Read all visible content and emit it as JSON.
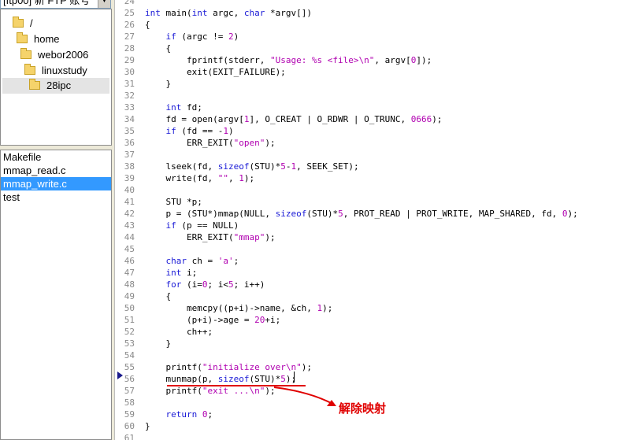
{
  "account_selector": {
    "value": "[ftp00] 新 FTP 账号"
  },
  "tree": {
    "items": [
      {
        "label": "/",
        "selected": false
      },
      {
        "label": "home",
        "selected": false
      },
      {
        "label": "webor2006",
        "selected": false
      },
      {
        "label": "linuxstudy",
        "selected": false
      },
      {
        "label": "28ipc",
        "selected": true
      }
    ]
  },
  "files": {
    "items": [
      {
        "label": "Makefile",
        "selected": false
      },
      {
        "label": "mmap_read.c",
        "selected": false
      },
      {
        "label": "mmap_write.c",
        "selected": true
      },
      {
        "label": "test",
        "selected": false
      }
    ]
  },
  "editor": {
    "line_numbers": [
      "24",
      "25",
      "26",
      "27",
      "28",
      "29",
      "30",
      "31",
      "32",
      "33",
      "34",
      "35",
      "36",
      "37",
      "38",
      "39",
      "40",
      "41",
      "42",
      "43",
      "44",
      "45",
      "46",
      "47",
      "48",
      "49",
      "50",
      "51",
      "52",
      "53",
      "54",
      "55",
      "56",
      "57",
      "58",
      "59",
      "60",
      "61"
    ],
    "current_line": "56",
    "lines": [
      "",
      "int main(int argc, char *argv[])",
      "{",
      "    if (argc != 2)",
      "    {",
      "        fprintf(stderr, \"Usage: %s <file>\\n\", argv[0]);",
      "        exit(EXIT_FAILURE);",
      "    }",
      "",
      "    int fd;",
      "    fd = open(argv[1], O_CREAT | O_RDWR | O_TRUNC, 0666);",
      "    if (fd == -1)",
      "        ERR_EXIT(\"open\");",
      "",
      "    lseek(fd, sizeof(STU)*5-1, SEEK_SET);",
      "    write(fd, \"\", 1);",
      "",
      "    STU *p;",
      "    p = (STU*)mmap(NULL, sizeof(STU)*5, PROT_READ | PROT_WRITE, MAP_SHARED, fd, 0);",
      "    if (p == NULL)",
      "        ERR_EXIT(\"mmap\");",
      "",
      "    char ch = 'a';",
      "    int i;",
      "    for (i=0; i<5; i++)",
      "    {",
      "        memcpy((p+i)->name, &ch, 1);",
      "        (p+i)->age = 20+i;",
      "        ch++;",
      "    }",
      "",
      "    printf(\"initialize over\\n\");",
      "    munmap(p, sizeof(STU)*5);",
      "    printf(\"exit ...\\n\");",
      "",
      "    return 0;",
      "}",
      ""
    ],
    "syntax_colors": {
      "keyword": "#1a1ad6",
      "string": "#b000b0",
      "number": "#b000b0",
      "text": "#000000"
    }
  },
  "annotation": {
    "text": "解除映射",
    "color": "#e00000"
  }
}
